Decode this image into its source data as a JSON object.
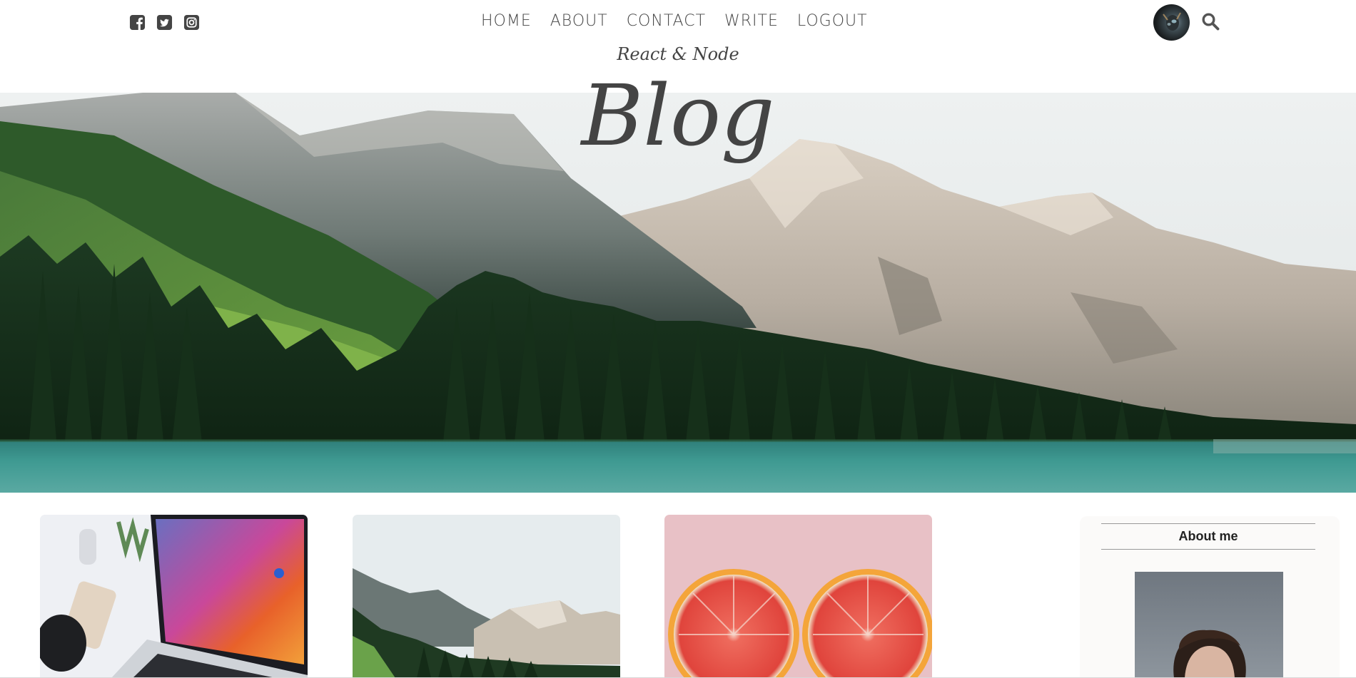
{
  "nav": {
    "social": [
      {
        "icon": "facebook-square-icon"
      },
      {
        "icon": "twitter-square-icon"
      },
      {
        "icon": "instagram-square-icon"
      }
    ],
    "links": [
      "HOME",
      "ABOUT",
      "CONTACT",
      "WRITE",
      "LOGOUT"
    ],
    "profile_icon": "user-avatar",
    "search_icon": "search-icon"
  },
  "header": {
    "subtitle": "React & Node",
    "title": "Blog"
  },
  "posts": [
    {
      "image": "laptop-desk-photo"
    },
    {
      "image": "mountain-forest-photo"
    },
    {
      "image": "grapefruit-halves-photo"
    }
  ],
  "sidebar": {
    "title": "About me",
    "image": "portrait-photo"
  },
  "colors": {
    "text": "#444444",
    "sidebar_bg": "#fbfaf9",
    "lake": "#3f9a92",
    "forest": "#1f3b22"
  }
}
